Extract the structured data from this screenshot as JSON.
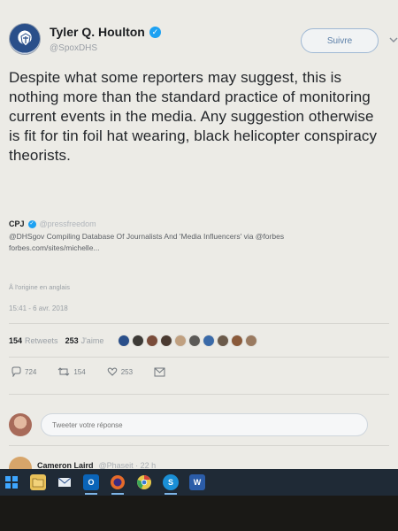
{
  "tweet": {
    "author_name": "Tyler Q. Houlton",
    "author_handle": "@SpoxDHS",
    "follow_label": "Suivre",
    "text": "Despite what some reporters may suggest, this is nothing more than the standard practice of monitoring current events in the media. Any suggestion otherwise is fit for tin foil hat wearing, black helicopter conspiracy theorists."
  },
  "quoted": {
    "name": "CPJ",
    "handle": "@pressfreedom",
    "line1": "@DHSgov Compiling Database Of Journalists And 'Media Influencers' via @forbes",
    "line2": "forbes.com/sites/michelle..."
  },
  "translate_label": "Å l'origine en anglais",
  "timestamp": "15:41 - 6 avr. 2018",
  "stats": {
    "retweets_count": "154",
    "retweets_label": "Retweets",
    "likes_count": "253",
    "likes_label": "J'aime"
  },
  "liker_colors": [
    "#2a4f8a",
    "#3d3a36",
    "#7a4c3a",
    "#4a3a30",
    "#c0a080",
    "#5c5a57",
    "#3a6aa8",
    "#6b5a4a",
    "#8a5a3a",
    "#9a7a60"
  ],
  "actions": {
    "reply_count": "724",
    "retweet_count": "154",
    "like_count": "253"
  },
  "reply_placeholder": "Tweeter votre réponse",
  "next_tweet": {
    "name": "Cameron Laird",
    "meta": "@Phaseit · 22 h"
  },
  "colors": {
    "accent": "#1da1f2",
    "background": "#ecebe6",
    "taskbar": "#1f2a36"
  },
  "taskbar_icons": [
    "windows-start-icon",
    "file-explorer-icon",
    "mail-icon",
    "outlook-icon",
    "firefox-icon",
    "chrome-icon",
    "skype-icon",
    "word-icon"
  ]
}
